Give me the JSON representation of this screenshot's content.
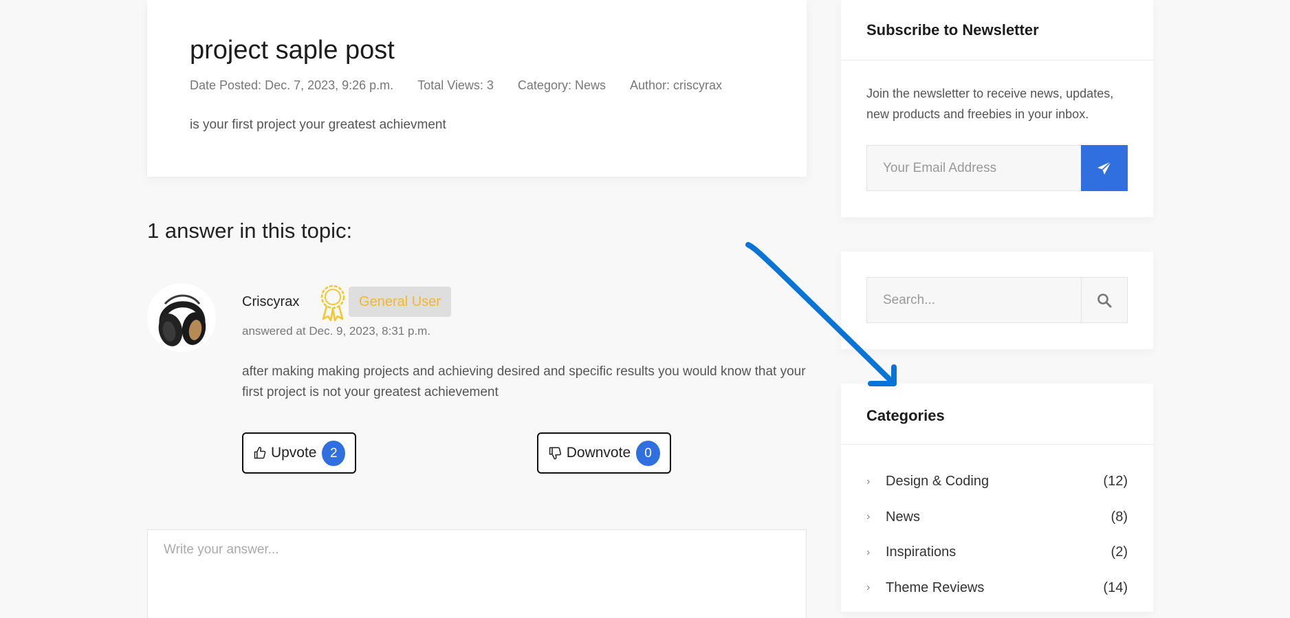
{
  "post": {
    "title": "project saple post",
    "meta": {
      "date": "Date Posted: Dec. 7, 2023, 9:26 p.m.",
      "views": "Total Views: 3",
      "category": "Category: News",
      "author": "Author: criscyrax"
    },
    "body": "is your first project your greatest achievment"
  },
  "answers_heading": "1 answer in this topic:",
  "answer": {
    "avatar_icon": "headphones-avatar",
    "author": "Criscyrax",
    "award_icon": "award-ribbon-icon",
    "role": "General User",
    "date": "answered at Dec. 9, 2023, 8:31 p.m.",
    "text": "after making making projects and achieving desired and specific results you would know that your first project is not your greatest achievement",
    "upvote_label": "Upvote",
    "upvote_count": "2",
    "downvote_label": "Downvote",
    "downvote_count": "0"
  },
  "answer_form": {
    "placeholder": "Write your answer..."
  },
  "sidebar": {
    "newsletter": {
      "title": "Subscribe to Newsletter",
      "text": "Join the newsletter to receive news, updates, new products and freebies in your inbox.",
      "email_placeholder": "Your Email Address",
      "send_icon": "paper-plane-icon"
    },
    "search": {
      "placeholder": "Search...",
      "icon": "search-icon"
    },
    "categories": {
      "title": "Categories",
      "items": [
        {
          "name": "Design & Coding",
          "count": "(12)"
        },
        {
          "name": "News",
          "count": "(8)"
        },
        {
          "name": "Inspirations",
          "count": "(2)"
        },
        {
          "name": "Theme Reviews",
          "count": "(14)"
        }
      ]
    }
  },
  "colors": {
    "accent": "#2f6fdf",
    "badge_text": "#f3b829",
    "badge_bg": "#dedede",
    "annotation_arrow": "#0a74d6"
  }
}
